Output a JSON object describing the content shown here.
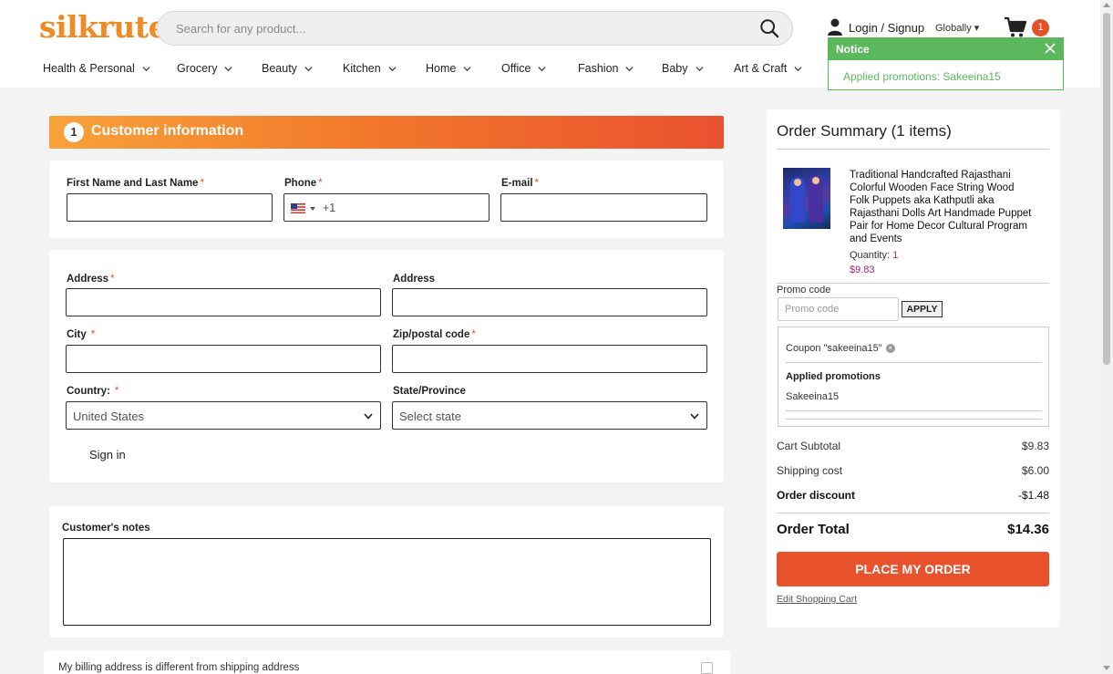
{
  "header": {
    "logo": "silkrute",
    "search_placeholder": "Search for any product...",
    "login": "Login / Signup",
    "region": "Globally",
    "cart_count": "1"
  },
  "nav": [
    {
      "label": "Health & Personal"
    },
    {
      "label": "Grocery"
    },
    {
      "label": "Beauty"
    },
    {
      "label": "Kitchen"
    },
    {
      "label": "Home"
    },
    {
      "label": "Office"
    },
    {
      "label": "Fashion"
    },
    {
      "label": "Baby"
    },
    {
      "label": "Art & Craft"
    }
  ],
  "notice": {
    "title": "Notice",
    "message": "Applied promotions: Sakeeina15"
  },
  "customer": {
    "step": "1",
    "title": "Customer information",
    "name_label": "First Name and Last Name",
    "phone_label": "Phone",
    "phone_dial": "+1",
    "email_label": "E-mail",
    "address_label": "Address",
    "address2_label": "Address",
    "city_label": "City",
    "zip_label": "Zip/postal code",
    "country_label": "Country:",
    "country_value": "United States",
    "state_label": "State/Province",
    "state_value": "Select state",
    "signin": "Sign in",
    "notes_label": "Customer's notes",
    "billing_text": "My billing address is different from shipping address"
  },
  "summary": {
    "title": "Order Summary (1 items)",
    "product_name": "Traditional Handcrafted Rajasthani Colorful Wooden Face String Wood Folk Puppets aka Kathputli aka Rajasthani Dolls Art Handmade Puppet Pair for Home Decor Cultural Program and Events",
    "quantity_label": "Quantity:",
    "quantity_value": "1",
    "price": "$9.83",
    "promo_label": "Promo code",
    "promo_placeholder": "Promo code",
    "apply": "APPLY",
    "coupon": "Coupon \"sakeeina15\"",
    "applied_title": "Applied promotions",
    "applied_value": "Sakeeina15",
    "subtotal_label": "Cart Subtotal",
    "subtotal_value": "$9.83",
    "shipping_label": "Shipping cost",
    "shipping_value": "$6.00",
    "discount_label": "Order discount",
    "discount_value": "-$1.48",
    "total_label": "Order Total",
    "total_value": "$14.36",
    "place_order": "PLACE MY ORDER",
    "edit_cart": "Edit Shopping Cart"
  },
  "colors": {
    "brand_orange": "#f08a24",
    "cta_red": "#e8532d",
    "notice_green": "#5cb85c",
    "price_magenta": "#a0287a"
  }
}
